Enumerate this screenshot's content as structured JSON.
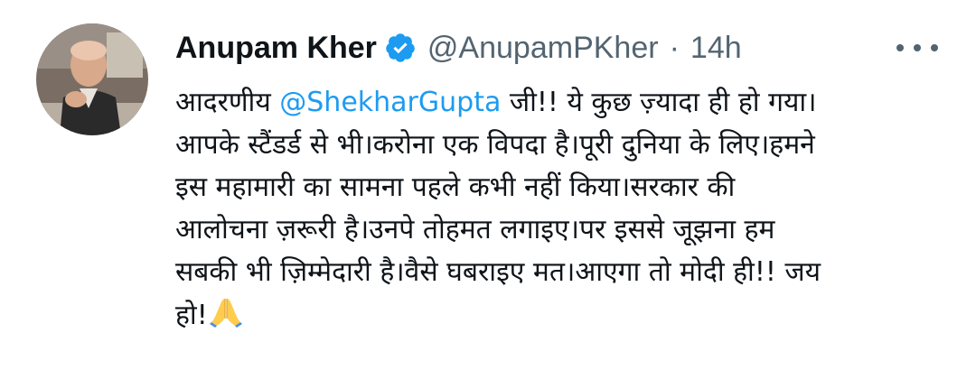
{
  "tweet": {
    "author_name": "Anupam Kher",
    "handle": "@AnupamPKher",
    "separator": "·",
    "time": "14h",
    "body": {
      "l1_pre": "आदरणीय ",
      "mention": "@ShekharGupta",
      "l1_post": " जी!! ये कुछ ज़्यादा ही हो गया।",
      "l2": "आपके स्टैंडर्ड से भी।करोना एक विपदा है।पूरी दुनिया के लिए।हमने",
      "l3": "इस महामारी का सामना पहले कभी नहीं किया।सरकार की",
      "l4": "आलोचना ज़रूरी है।उनपे तोहमत लगाइए।पर इससे जूझना हम",
      "l5": "सबकी भी ज़िम्मेदारी है।वैसे घबराइए मत।आएगा तो मोदी ही!! जय",
      "l6": "हो!"
    }
  },
  "icons": {
    "verified": "verified-badge-icon",
    "more": "more-options-icon",
    "emoji": "folded-hands-emoji-icon"
  },
  "colors": {
    "text": "#0f1419",
    "secondary": "#536471",
    "accent": "#1d9bf0"
  }
}
